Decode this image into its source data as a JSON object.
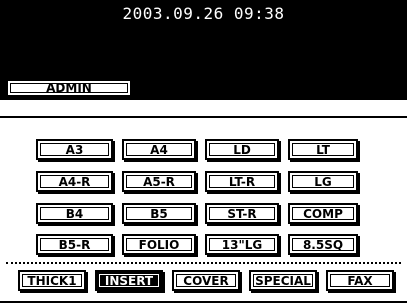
{
  "header": {
    "datetime": "2003.09.26 09:38"
  },
  "tabs": [
    {
      "label": "ADMIN"
    }
  ],
  "paper_sizes": [
    [
      "A3",
      "A4",
      "LD",
      "LT"
    ],
    [
      "A4-R",
      "A5-R",
      "LT-R",
      "LG"
    ],
    [
      "B4",
      "B5",
      "ST-R",
      "COMP"
    ],
    [
      "B5-R",
      "FOLIO",
      "13\"LG",
      "8.5SQ"
    ]
  ],
  "special": {
    "thick": "THICK1",
    "insert": "INSERT",
    "cover": "COVER",
    "special": "SPECIAL",
    "fax": "FAX",
    "selected": "INSERT"
  }
}
